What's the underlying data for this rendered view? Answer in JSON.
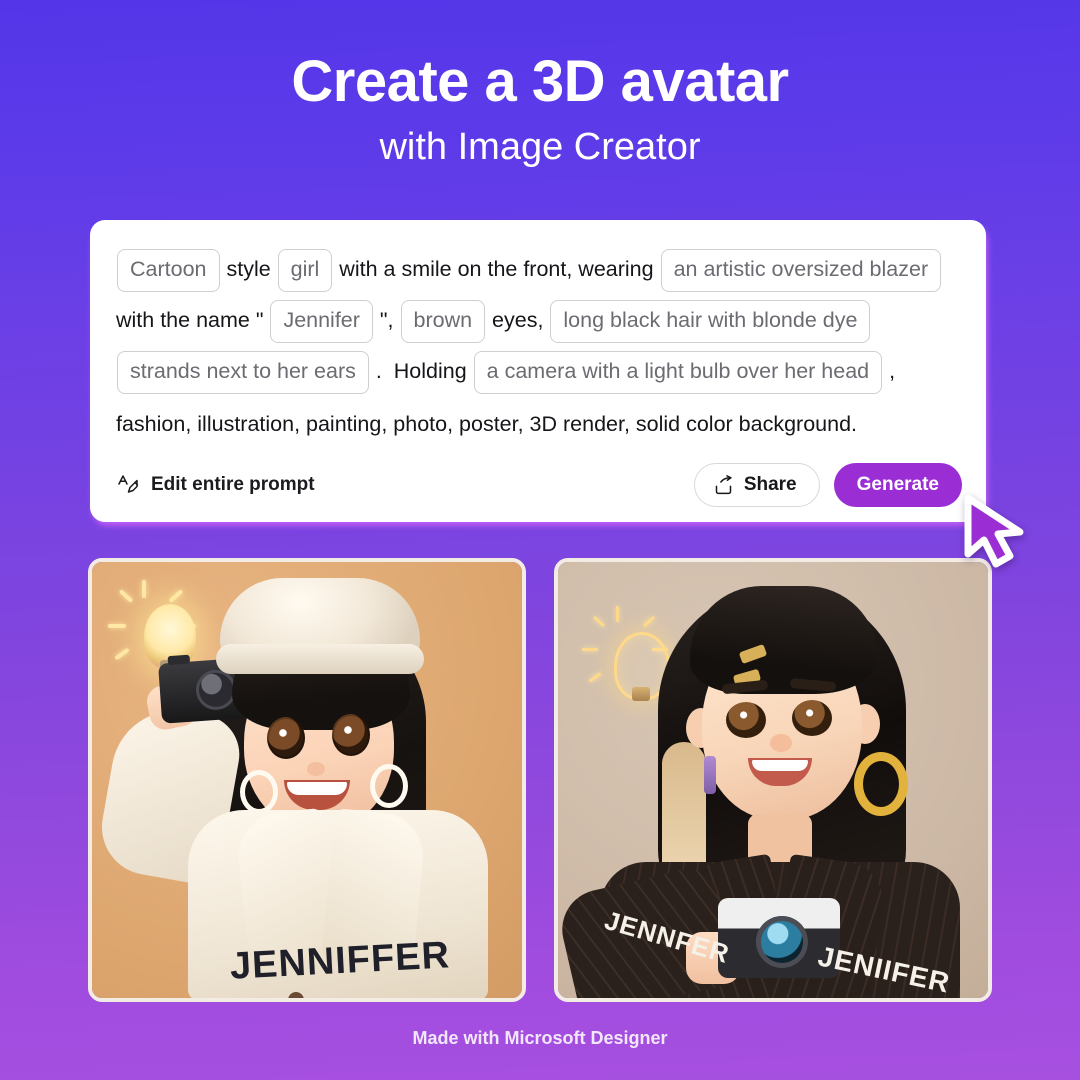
{
  "header": {
    "title": "Create a 3D avatar",
    "subtitle": "with Image Creator"
  },
  "prompt_card": {
    "line1": [
      {
        "type": "tag",
        "text": "Cartoon"
      },
      {
        "type": "text",
        "text": " style "
      },
      {
        "type": "tag",
        "text": "girl"
      },
      {
        "type": "text",
        "text": " with a smile on the front, wearing "
      },
      {
        "type": "tag",
        "text": "an artistic oversized blazer"
      }
    ],
    "line2": [
      {
        "type": "text",
        "text": "with the name \" "
      },
      {
        "type": "tag",
        "text": "Jennifer"
      },
      {
        "type": "text",
        "text": " \", "
      },
      {
        "type": "tag",
        "text": "brown"
      },
      {
        "type": "text",
        "text": " eyes, "
      },
      {
        "type": "tag",
        "text": "long black hair with blonde dye"
      }
    ],
    "line3": [
      {
        "type": "tag",
        "text": "strands next to her ears"
      },
      {
        "type": "text",
        "text": " .  Holding "
      },
      {
        "type": "tag",
        "text": "a camera with a light bulb over her head"
      },
      {
        "type": "text",
        "text": " ,"
      }
    ],
    "line4": "fashion, illustration, painting, photo, poster, 3D render, solid color background.",
    "tags": {
      "cartoon": "Cartoon",
      "girl": "girl",
      "blazer": "an artistic oversized blazer",
      "name": "Jennifer",
      "eyes": "brown",
      "hair": "long black hair with blonde dye",
      "strands": "strands next to her ears",
      "holding": "a camera with a light bulb over her head"
    },
    "static_text": {
      "style": " style ",
      "smile": " with a smile on the front, wearing ",
      "with_the_name": "with the name \" ",
      "quote_comma": " \", ",
      "eyes_label": " eyes, ",
      "period": " .  ",
      "holding_label": "Holding ",
      "trailing_comma": " ,"
    },
    "actions": {
      "edit_label": "Edit entire prompt",
      "edit_icon": "edit-prompt-icon",
      "share_label": "Share",
      "share_icon": "share-icon",
      "generate_label": "Generate",
      "generate_color": "#9a2dd4"
    }
  },
  "cursor": {
    "icon": "mouse-pointer-icon",
    "fill": "#9a2dd4",
    "stroke": "#ffffff"
  },
  "results": [
    {
      "alt": "3D cartoon avatar of a smiling girl in a cream beret and oversized cream coat holding a camera, with a glowing light bulb above her head",
      "background_color": "#dda66f",
      "coat_name_text": "JENNIFFER"
    },
    {
      "alt": "3D cartoon avatar of a smiling girl with long black hair and blonde strands, gold hoop earring, dark pinstripe blazer, holding a camera, with a glowing light bulb outline",
      "background_color": "#ccb8a5",
      "blazer_left_text": "JENNFER",
      "blazer_right_text": "JENIIFER"
    }
  ],
  "footer": {
    "text": "Made with Microsoft Designer"
  },
  "theme": {
    "gradient_top": "#5436e8",
    "gradient_bottom": "#a750e0",
    "card_background": "#ffffff",
    "tag_border": "#cfcfd2",
    "tag_text": "#6b6b72",
    "prompt_text": "#16161a"
  }
}
